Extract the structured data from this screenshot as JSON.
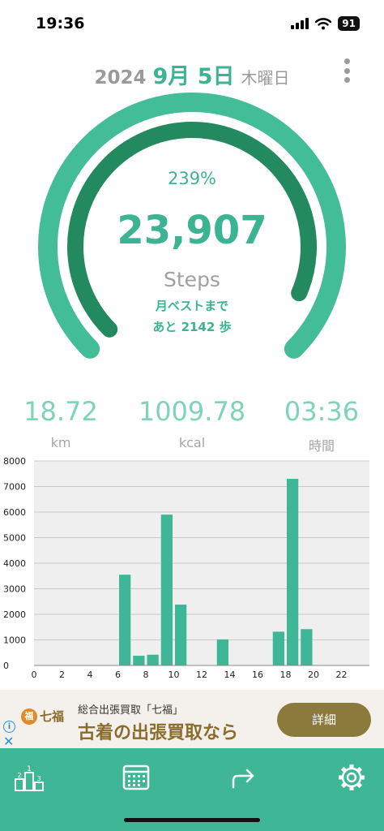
{
  "status_bar": {
    "time": "19:36",
    "battery": "91"
  },
  "header": {
    "year": "2024",
    "month_day": "9月 5日",
    "weekday": "木曜日"
  },
  "gauge": {
    "percent_text": "239%",
    "steps": "23,907",
    "steps_label": "Steps",
    "best_line1": "月ベストまで",
    "best_line2": "あと 2142 歩",
    "outer_progress": 1.0,
    "inner_progress": 0.92
  },
  "stats": {
    "distance": {
      "value": "18.72",
      "label": "km"
    },
    "calories": {
      "value": "1009.78",
      "label": "kcal"
    },
    "time": {
      "value": "03:36",
      "label": "時間"
    }
  },
  "chart_data": {
    "type": "bar",
    "x": [
      0,
      1,
      2,
      3,
      4,
      5,
      6,
      7,
      8,
      9,
      10,
      11,
      12,
      13,
      14,
      15,
      16,
      17,
      18,
      19,
      20,
      21,
      22,
      23
    ],
    "values": [
      0,
      0,
      0,
      0,
      0,
      0,
      3550,
      380,
      420,
      5900,
      2380,
      0,
      0,
      1020,
      0,
      0,
      0,
      1320,
      7300,
      1420,
      0,
      0,
      0,
      0
    ],
    "xticks": [
      "0",
      "2",
      "4",
      "6",
      "8",
      "10",
      "12",
      "14",
      "16",
      "18",
      "20",
      "22"
    ],
    "yticks": [
      "0",
      "1000",
      "2000",
      "3000",
      "4000",
      "5000",
      "6000",
      "7000",
      "8000"
    ],
    "ylim": [
      0,
      8000
    ],
    "grid": true,
    "bar_color": "#3fb696",
    "plot_bg": "#efefef"
  },
  "ad": {
    "logo_text": "七福",
    "small_text": "総合出張買取「七福」",
    "big_text": "古着の出張買取なら",
    "button": "詳細"
  },
  "nav": {
    "items": [
      "ranking-icon",
      "calendar-icon",
      "share-icon",
      "gear-icon"
    ]
  },
  "colors": {
    "accent": "#3cb393",
    "dark_accent": "#238a60",
    "light_accent": "#7fd3b9"
  }
}
